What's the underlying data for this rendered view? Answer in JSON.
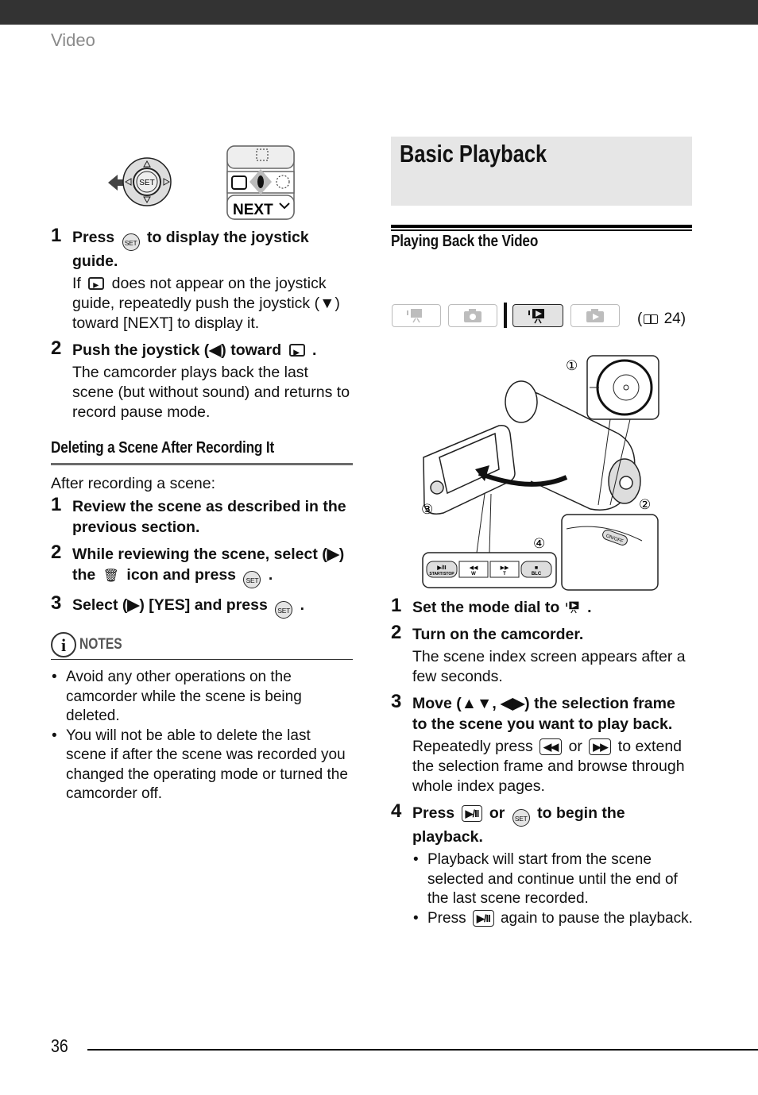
{
  "header": {
    "section": "Video"
  },
  "left_column": {
    "joystick_figure": {
      "center_label": "SET",
      "guide_bottom_label": "NEXT"
    },
    "review_steps": [
      {
        "number": "1",
        "head_before_icon": "Press",
        "head_icon": "SET",
        "head_after_icon": "to display the joystick guide.",
        "body_before_icon": "If",
        "body_icon": "record-review-icon",
        "body_after_icon": "does not appear on the joystick guide, repeatedly push the joystick (▼) toward [NEXT] to display it."
      },
      {
        "number": "2",
        "head_before_icon": "Push the joystick (◀) toward",
        "head_icon": "record-review-icon",
        "head_after_icon": ".",
        "body": "The camcorder plays back the last scene (but without sound) and returns to record pause mode."
      }
    ],
    "delete_section": {
      "heading": "Deleting a Scene After Recording It",
      "intro": "After recording a scene:",
      "steps": [
        {
          "number": "1",
          "head": "Review the scene as described in the previous section."
        },
        {
          "number": "2",
          "head_before_icon": "While reviewing the scene, select (▶) the",
          "trash_icon": "🗑",
          "head_middle": "icon and press",
          "set_icon": "SET",
          "head_end": "."
        },
        {
          "number": "3",
          "head_before_icon": "Select (▶) [YES] and press",
          "set_icon": "SET",
          "head_end": "."
        }
      ]
    },
    "notes": {
      "icon": "i",
      "label": "NOTES",
      "items": [
        "Avoid any other operations on the camcorder while the scene is being deleted.",
        "You will not be able to delete the last scene if after the scene was recorded you changed the operating mode or turned the camcorder off."
      ]
    }
  },
  "right_column": {
    "title": "Basic Playback",
    "subheading": "Playing Back the Video",
    "mode_icons": [
      {
        "name": "movie-record-mode",
        "active": false
      },
      {
        "name": "photo-record-mode",
        "active": false
      },
      {
        "name": "movie-playback-mode",
        "active": true
      },
      {
        "name": "photo-playback-mode",
        "active": false
      }
    ],
    "page_reference": "24",
    "camera_figure": {
      "callouts": [
        "①",
        "②",
        "③",
        "④"
      ],
      "buttons": [
        {
          "symbol": "▶/II",
          "label": "START/STOP"
        },
        {
          "symbol": "◀◀",
          "label": "W"
        },
        {
          "symbol": "▶▶",
          "label": "T"
        },
        {
          "symbol": "■",
          "label": "BLC"
        }
      ],
      "power_label": "ON/OFF"
    },
    "steps": [
      {
        "number": "1",
        "head_before_icon": "Set the mode dial to",
        "head_end": "."
      },
      {
        "number": "2",
        "head": "Turn on the camcorder.",
        "body": "The scene index screen appears after a few seconds."
      },
      {
        "number": "3",
        "head": "Move (▲▼, ◀▶) the selection frame to the scene you want to play back.",
        "body_before": "Repeatedly press",
        "btn_a": "◀◀",
        "body_or": "or",
        "btn_b": "▶▶",
        "body_after": "to extend the selection frame and browse through whole index pages."
      },
      {
        "number": "4",
        "head_before": "Press",
        "btn": "▶/II",
        "head_or": "or",
        "set_icon": "SET",
        "head_after": "to begin the playback.",
        "bullets": [
          {
            "text": "Playback will start from the scene selected and continue until the end of the last scene recorded."
          },
          {
            "before": "Press",
            "btn": "▶/II",
            "after": "again to pause the playback."
          }
        ]
      }
    ]
  },
  "footer": {
    "page_number": "36"
  }
}
